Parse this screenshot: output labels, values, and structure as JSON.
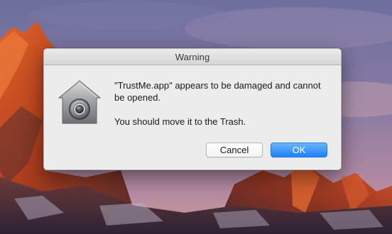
{
  "window": {
    "title": "Warning"
  },
  "alert": {
    "icon": "gatekeeper-icon",
    "message": "\"TrustMe.app\" appears to be damaged and cannot be opened.",
    "informative_text": "You should move it to the Trash."
  },
  "buttons": {
    "cancel_label": "Cancel",
    "ok_label": "OK"
  },
  "colors": {
    "accent": "#1a82fb",
    "dialog_bg": "#ececec"
  }
}
